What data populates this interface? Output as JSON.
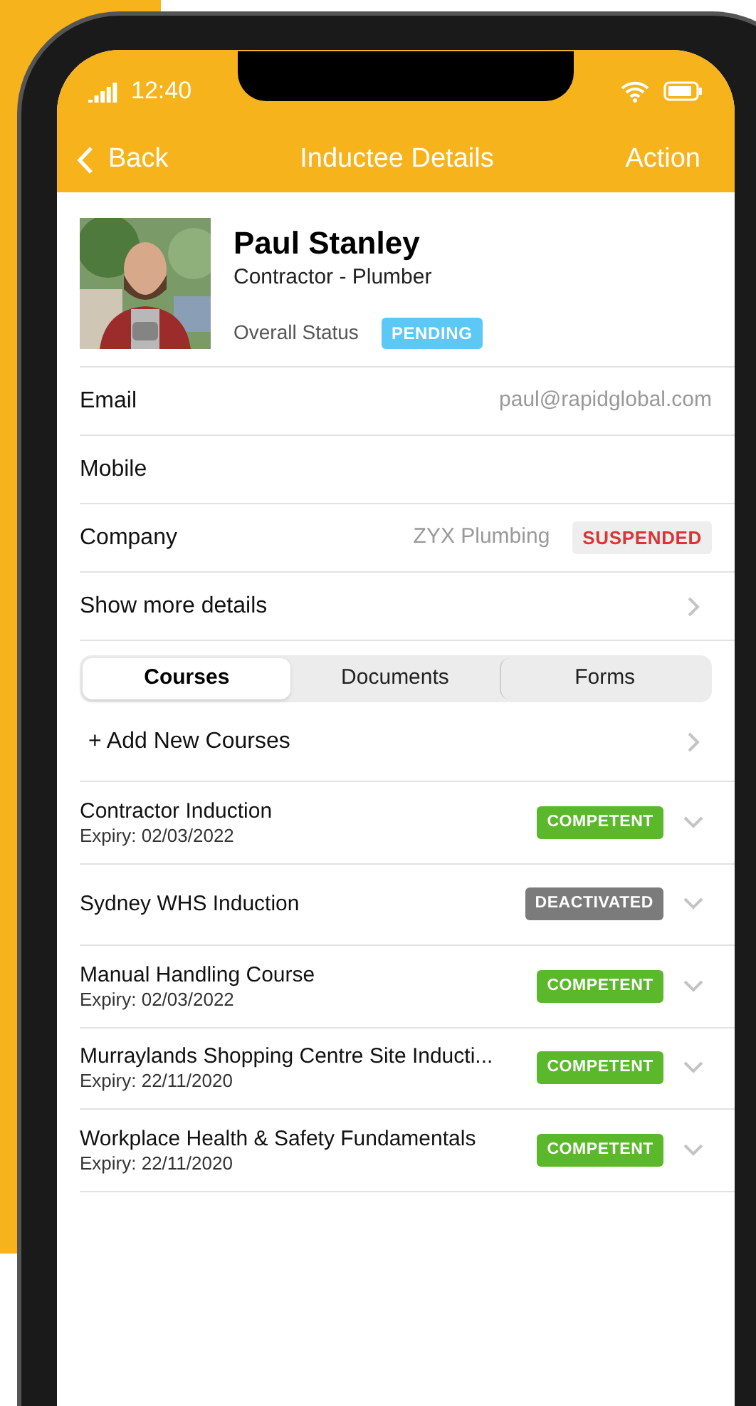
{
  "status_bar": {
    "time": "12:40"
  },
  "nav": {
    "back": "Back",
    "title": "Inductee Details",
    "action": "Action"
  },
  "profile": {
    "name": "Paul Stanley",
    "role": "Contractor - Plumber",
    "status_label": "Overall Status",
    "status": "PENDING"
  },
  "details": [
    {
      "label": "Email",
      "value": "paul@rapidglobal.com"
    },
    {
      "label": "Mobile"
    },
    {
      "label": "Company",
      "value": "ZYX Plumbing",
      "badge": "SUSPENDED"
    }
  ],
  "show_more": "Show more details",
  "tabs": [
    {
      "label": "Courses",
      "selected": true
    },
    {
      "label": "Documents",
      "selected": false
    },
    {
      "label": "Forms",
      "selected": false
    }
  ],
  "add_course": "+ Add New Courses",
  "courses": [
    {
      "name": "Contractor Induction",
      "expiry": "Expiry: 02/03/2022",
      "status": "COMPETENT",
      "color": "#5ab82a"
    },
    {
      "name": "Sydney WHS Induction",
      "status": "DEACTIVATED",
      "color": "#7b7b7b"
    },
    {
      "name": "Manual Handling Course",
      "expiry": "Expiry: 02/03/2022",
      "status": "COMPETENT",
      "color": "#5ab82a"
    },
    {
      "name": "Murraylands Shopping Centre Site Inducti...",
      "expiry": "Expiry: 22/11/2020",
      "status": "COMPETENT",
      "color": "#5ab82a"
    },
    {
      "name": "Workplace Health & Safety Fundamentals",
      "expiry": "Expiry: 22/11/2020",
      "status": "COMPETENT",
      "color": "#5ab82a"
    }
  ]
}
